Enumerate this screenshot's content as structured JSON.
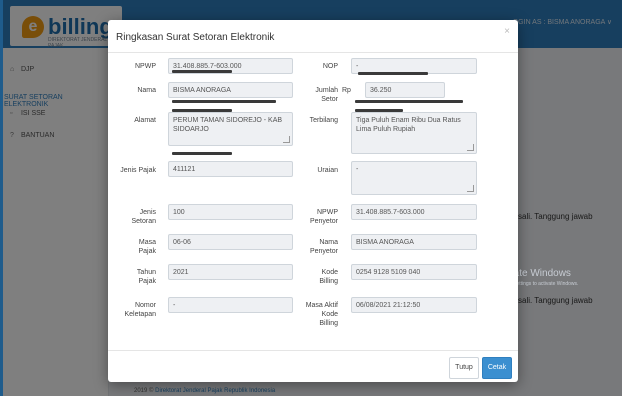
{
  "app": {
    "logo_letter": "e",
    "logo_text": "billing",
    "logo_sub": "DIREKTORAT JENDERAL PAJAK",
    "user": "OGIN AS : BISMA ANORAGA ∨",
    "sidebar": [
      "DJP",
      "SURAT SETORAN ELEKTRONIK",
      "ISI SSE",
      "BANTUAN"
    ],
    "bg_text_1": "sali. Tanggung jawab",
    "bg_text_2": "sali. Tanggung jawab",
    "footer_prefix": "2019 ©",
    "footer_link": "Direktorat Jenderal Pajak Republik Indonesia",
    "watermark_1": "Activate Windows",
    "watermark_2": "Go to PC settings to activate Windows."
  },
  "modal": {
    "title": "Ringkasan Surat Setoran Elektronik",
    "close": "×",
    "left": {
      "npwp_label": "NPWP",
      "npwp_value": "31.408.885.7-603.000",
      "nama_label": "Nama",
      "nama_value": "BISMA ANORAGA",
      "alamat_label": "Alamat",
      "alamat_value_1": "PERUM TAMAN SIDOREJO - KAB",
      "alamat_value_2": "SIDOARJO",
      "jenis_pajak_label": "Jenis Pajak",
      "jenis_pajak_value": "411121",
      "jenis_setoran_label_1": "Jenis",
      "jenis_setoran_label_2": "Setoran",
      "jenis_setoran_value": "100",
      "masa_pajak_label_1": "Masa",
      "masa_pajak_label_2": "Pajak",
      "masa_pajak_value": "06-06",
      "tahun_pajak_label_1": "Tahun",
      "tahun_pajak_label_2": "Pajak",
      "tahun_pajak_value": "2021",
      "nomor_ketetapan_label_1": "Nomor",
      "nomor_ketetapan_label_2": "Keletapan",
      "nomor_ketetapan_value": "-"
    },
    "right": {
      "nop_label": "NOP",
      "nop_value": "-",
      "jumlah_setor_label_1": "Jumlah",
      "jumlah_setor_label_2": "Setor",
      "currency": "Rp",
      "jumlah_setor_value": "36.250",
      "terbilang_label": "Terbilang",
      "terbilang_value_1": "Tiga Puluh Enam Ribu Dua Ratus",
      "terbilang_value_2": "Lima Puluh  Rupiah",
      "uraian_label": "Uraian",
      "uraian_value": "-",
      "npwp_penyetor_label_1": "NPWP",
      "npwp_penyetor_label_2": "Penyetor",
      "npwp_penyetor_value": "31.408.885.7-603.000",
      "nama_penyetor_label_1": "Nama",
      "nama_penyetor_label_2": "Penyetor",
      "nama_penyetor_value": "BISMA ANORAGA",
      "kode_billing_label_1": "Kode",
      "kode_billing_label_2": "Billing",
      "kode_billing_value": "0254 9128 5109 040",
      "masa_aktif_label_1": "Masa Aktif",
      "masa_aktif_label_2": "Kode",
      "masa_aktif_label_3": "Billing",
      "masa_aktif_value": "06/08/2021 21:12:50"
    },
    "buttons": {
      "tutup": "Tutup",
      "cetak": "Cetak"
    }
  }
}
